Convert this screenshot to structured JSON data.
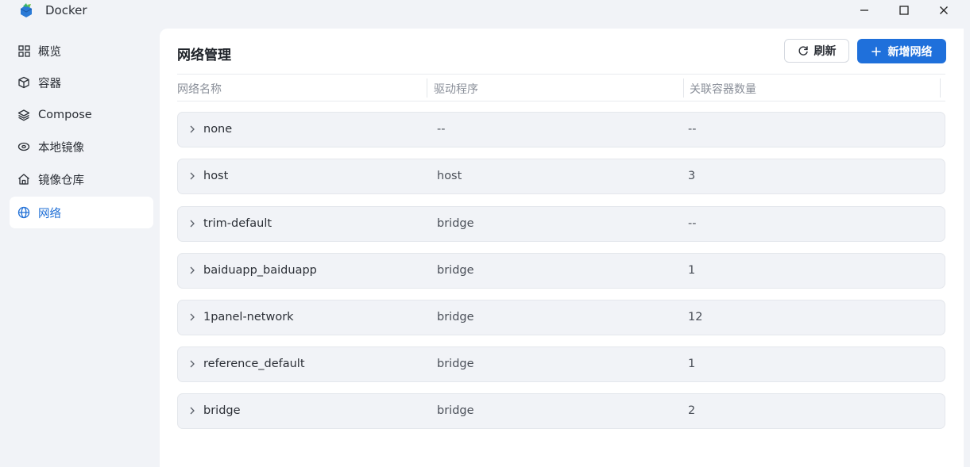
{
  "window": {
    "title": "Docker"
  },
  "sidebar": {
    "items": [
      {
        "label": "概览",
        "icon": "grid-icon"
      },
      {
        "label": "容器",
        "icon": "cube-icon"
      },
      {
        "label": "Compose",
        "icon": "layers-icon"
      },
      {
        "label": "本地镜像",
        "icon": "disk-icon"
      },
      {
        "label": "镜像仓库",
        "icon": "house-icon"
      },
      {
        "label": "网络",
        "icon": "globe-icon",
        "active": true
      }
    ]
  },
  "main": {
    "title": "网络管理",
    "refresh_label": "刷新",
    "add_label": "新增网络",
    "columns": [
      "网络名称",
      "驱动程序",
      "关联容器数量"
    ],
    "rows": [
      {
        "name": "none",
        "driver": "--",
        "count": "--"
      },
      {
        "name": "host",
        "driver": "host",
        "count": "3"
      },
      {
        "name": "trim-default",
        "driver": "bridge",
        "count": "--"
      },
      {
        "name": "baiduapp_baiduapp",
        "driver": "bridge",
        "count": "1"
      },
      {
        "name": "1panel-network",
        "driver": "bridge",
        "count": "12"
      },
      {
        "name": "reference_default",
        "driver": "bridge",
        "count": "1"
      },
      {
        "name": "bridge",
        "driver": "bridge",
        "count": "2"
      }
    ]
  },
  "colors": {
    "accent": "#1f70db",
    "panel": "#ffffff",
    "background": "#f1f3f7",
    "row": "#f1f3f7"
  }
}
